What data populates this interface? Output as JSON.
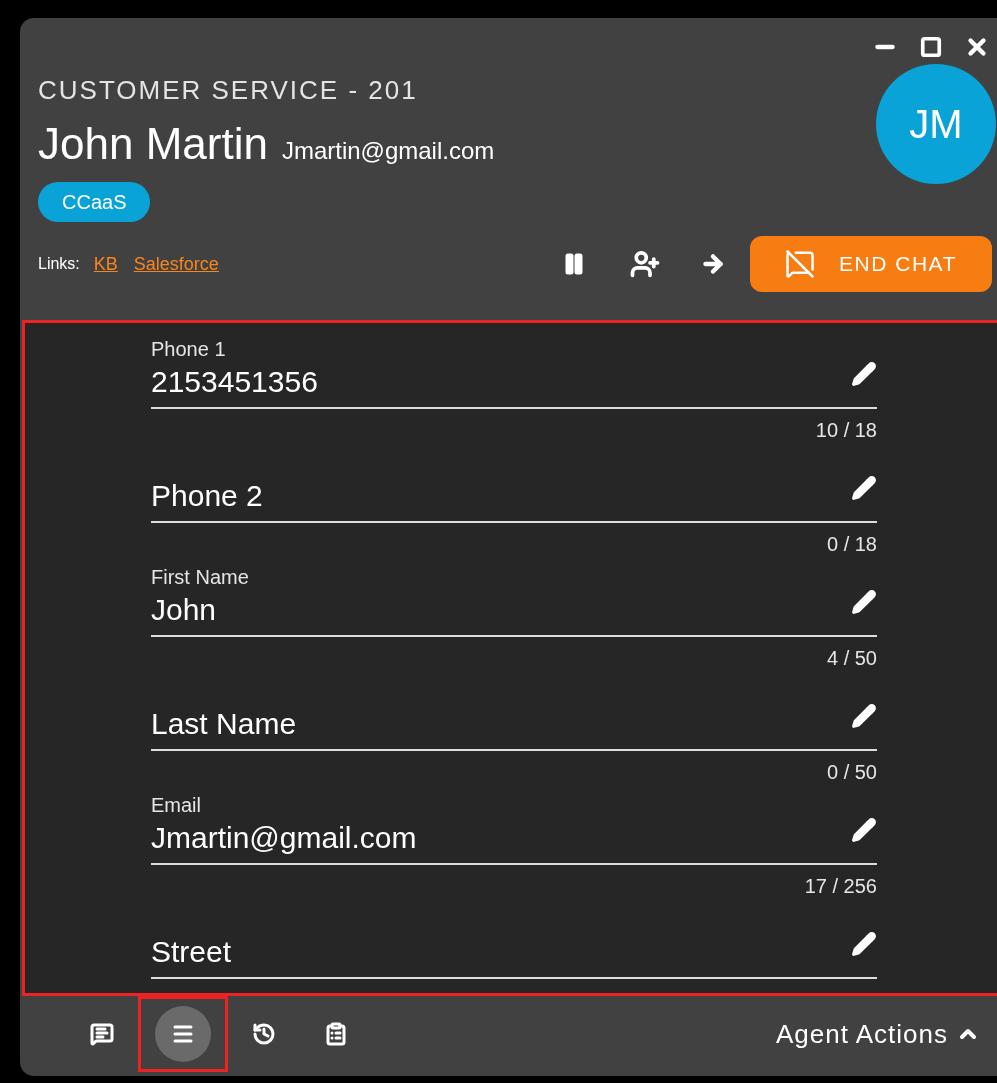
{
  "window": {
    "queue": "CUSTOMER SERVICE - 201",
    "customer_name": "John Martin",
    "customer_email": "Jmartin@gmail.com",
    "tag": "CCaaS",
    "avatar_initials": "JM"
  },
  "links": {
    "label": "Links:",
    "items": [
      "KB",
      "Salesforce"
    ]
  },
  "end_chat_button": "END CHAT",
  "fields": [
    {
      "label": "Phone 1",
      "value": "2153451356",
      "counter": "10 / 18"
    },
    {
      "label": "Phone 2",
      "counter": "0 / 18"
    },
    {
      "label": "First Name",
      "value": "John",
      "counter": "4 / 50"
    },
    {
      "label": "Last Name",
      "counter": "0 / 50"
    },
    {
      "label": "Email",
      "value": "Jmartin@gmail.com",
      "counter": "17 / 256"
    },
    {
      "label": "Street"
    }
  ],
  "bottom_tabs": [
    {
      "kind": "chat",
      "selected": false
    },
    {
      "kind": "details",
      "selected": true
    },
    {
      "kind": "history",
      "selected": false
    },
    {
      "kind": "notes",
      "selected": false
    }
  ],
  "agent_actions": {
    "label": "Agent Actions",
    "expanded": false
  }
}
